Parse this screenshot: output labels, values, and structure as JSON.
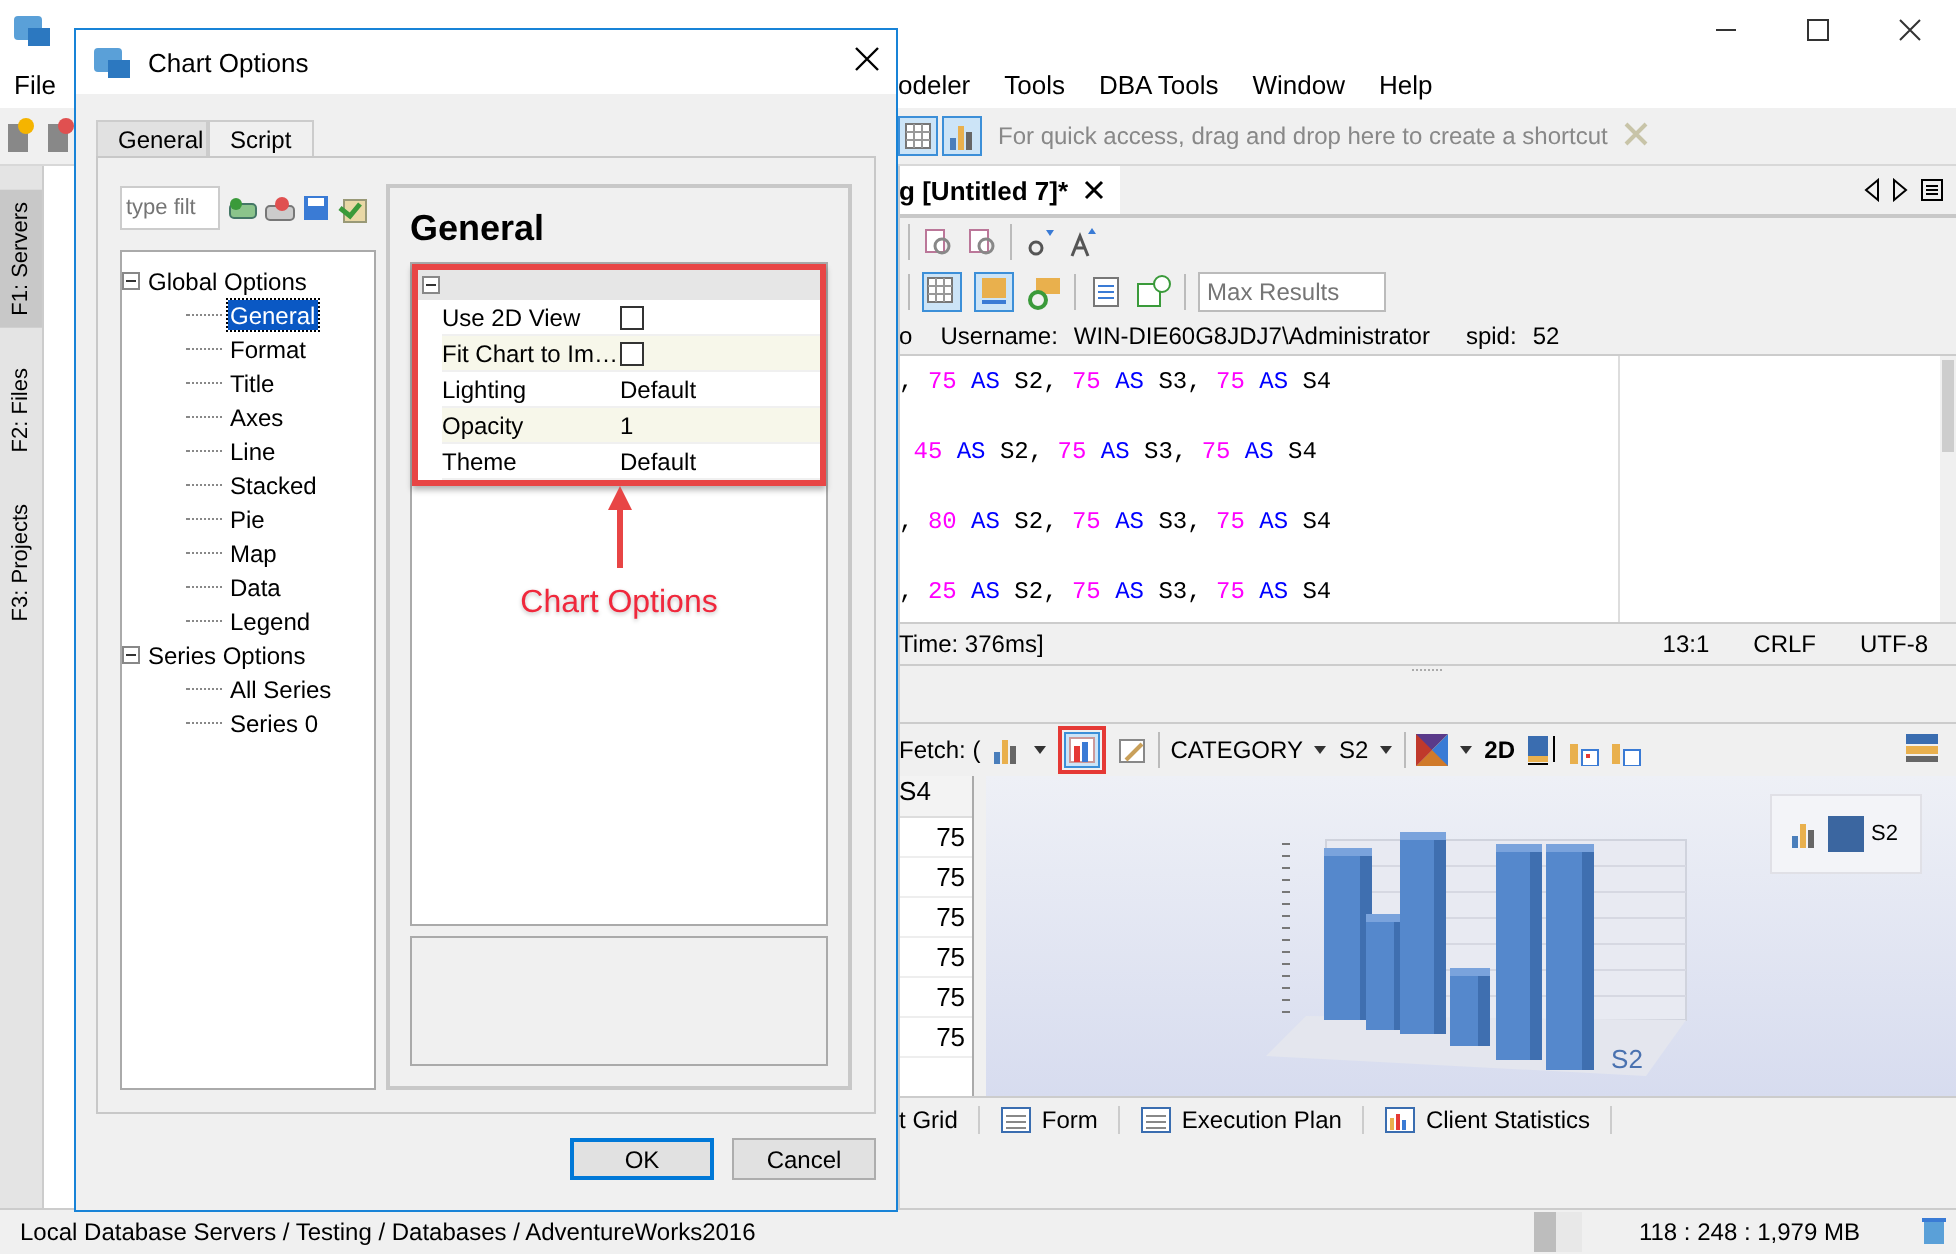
{
  "menu": {
    "left": [
      "File"
    ],
    "right": [
      "odeler",
      "Tools",
      "DBA Tools",
      "Window",
      "Help"
    ]
  },
  "quick_access": {
    "hint": "For quick access, drag and drop here to create a shortcut"
  },
  "sidebar": {
    "tabs": [
      {
        "label": "F1: Servers",
        "selected": true
      },
      {
        "label": "F2: Files",
        "selected": false
      },
      {
        "label": "F3: Projects",
        "selected": false
      }
    ]
  },
  "editor": {
    "tab": {
      "title": "g [Untitled 7]*"
    },
    "max_results": {
      "placeholder": "Max Results"
    },
    "connection": {
      "prefix": "o",
      "username_label": "Username:",
      "username": "WIN-DIE60G8JDJ7\\Administrator",
      "spid_label": "spid:",
      "spid": "52"
    },
    "code_lines": [
      [
        {
          "kind": "plain",
          "text": ", "
        },
        {
          "kind": "number",
          "text": "75"
        },
        {
          "kind": "keyword",
          "text": " AS"
        },
        {
          "kind": "plain",
          "text": " S2, "
        },
        {
          "kind": "number",
          "text": "75"
        },
        {
          "kind": "keyword",
          "text": " AS"
        },
        {
          "kind": "plain",
          "text": " S3, "
        },
        {
          "kind": "number",
          "text": "75"
        },
        {
          "kind": "keyword",
          "text": " AS"
        },
        {
          "kind": "plain",
          "text": " S4"
        }
      ],
      [
        {
          "kind": "number",
          "text": " 45"
        },
        {
          "kind": "keyword",
          "text": " AS"
        },
        {
          "kind": "plain",
          "text": " S2, "
        },
        {
          "kind": "number",
          "text": "75"
        },
        {
          "kind": "keyword",
          "text": " AS"
        },
        {
          "kind": "plain",
          "text": " S3, "
        },
        {
          "kind": "number",
          "text": "75"
        },
        {
          "kind": "keyword",
          "text": " AS"
        },
        {
          "kind": "plain",
          "text": " S4"
        }
      ],
      [
        {
          "kind": "plain",
          "text": ", "
        },
        {
          "kind": "number",
          "text": "80"
        },
        {
          "kind": "keyword",
          "text": " AS"
        },
        {
          "kind": "plain",
          "text": " S2, "
        },
        {
          "kind": "number",
          "text": "75"
        },
        {
          "kind": "keyword",
          "text": " AS"
        },
        {
          "kind": "plain",
          "text": " S3, "
        },
        {
          "kind": "number",
          "text": "75"
        },
        {
          "kind": "keyword",
          "text": " AS"
        },
        {
          "kind": "plain",
          "text": " S4"
        }
      ],
      [
        {
          "kind": "plain",
          "text": ", "
        },
        {
          "kind": "number",
          "text": "25"
        },
        {
          "kind": "keyword",
          "text": " AS"
        },
        {
          "kind": "plain",
          "text": " S2, "
        },
        {
          "kind": "number",
          "text": "75"
        },
        {
          "kind": "keyword",
          "text": " AS"
        },
        {
          "kind": "plain",
          "text": " S3, "
        },
        {
          "kind": "number",
          "text": "75"
        },
        {
          "kind": "keyword",
          "text": " AS"
        },
        {
          "kind": "plain",
          "text": " S4"
        }
      ]
    ],
    "status": {
      "time": "Time: 376ms]",
      "position": "13:1",
      "line_ending": "CRLF",
      "encoding": "UTF-8"
    }
  },
  "results": {
    "fetch_label": "Fetch: (",
    "category": "CATEGORY",
    "series": "S2",
    "mode": "2D",
    "grid": {
      "column": "S4",
      "rows": [
        "75",
        "75",
        "75",
        "75",
        "75",
        "75"
      ]
    },
    "chart": {
      "legend": [
        "S2"
      ],
      "axis_label": "S2"
    },
    "tabs": [
      "t Grid",
      "Form",
      "Execution Plan",
      "Client Statistics"
    ]
  },
  "status_bar": {
    "path": "Local Database Servers / Testing / Databases / AdventureWorks2016",
    "memory": {
      "text": "118 : 248 : 1,979 MB",
      "level": 0.45
    }
  },
  "dialog": {
    "title": "Chart Options",
    "tabs": [
      {
        "label": "General",
        "selected": true
      },
      {
        "label": "Script",
        "selected": false
      }
    ],
    "filter": {
      "placeholder": "type filt"
    },
    "tree": [
      {
        "label": "Global Options",
        "expanded": true,
        "selected": false,
        "children": [
          {
            "label": "General",
            "selected": true
          },
          {
            "label": "Format",
            "selected": false
          },
          {
            "label": "Title",
            "selected": false
          },
          {
            "label": "Axes",
            "selected": false
          },
          {
            "label": "Line",
            "selected": false
          },
          {
            "label": "Stacked",
            "selected": false
          },
          {
            "label": "Pie",
            "selected": false
          },
          {
            "label": "Map",
            "selected": false
          },
          {
            "label": "Data",
            "selected": false
          },
          {
            "label": "Legend",
            "selected": false
          }
        ]
      },
      {
        "label": "Series Options",
        "expanded": true,
        "selected": false,
        "children": [
          {
            "label": "All Series",
            "selected": false
          },
          {
            "label": "Series 0",
            "selected": false
          }
        ]
      }
    ],
    "panel_title": "General",
    "properties": [
      {
        "kind": "checkbox",
        "name": "Use 2D View",
        "checked": false
      },
      {
        "kind": "checkbox",
        "name": "Fit Chart to Im…",
        "checked": false
      },
      {
        "kind": "text",
        "name": "Lighting",
        "value": "Default"
      },
      {
        "kind": "text",
        "name": "Opacity",
        "value": "1"
      },
      {
        "kind": "text",
        "name": "Theme",
        "value": "Default"
      }
    ],
    "annotation": "Chart Options",
    "buttons": [
      {
        "label": "OK",
        "default": true
      },
      {
        "label": "Cancel",
        "default": false
      }
    ]
  }
}
